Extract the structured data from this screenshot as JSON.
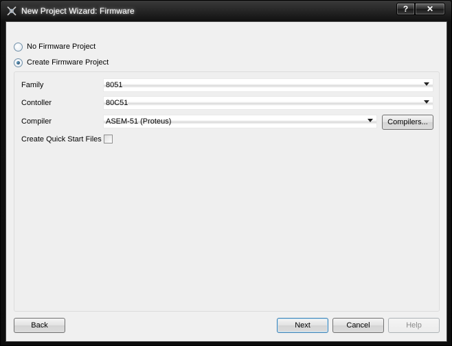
{
  "window": {
    "title": "New Project Wizard: Firmware",
    "help_glyph": "?",
    "close_glyph": "✕"
  },
  "options": {
    "no_firmware": {
      "label": "No Firmware Project",
      "selected": false
    },
    "create_firmware": {
      "label": "Create Firmware Project",
      "selected": true
    }
  },
  "form": {
    "family": {
      "label": "Family",
      "value": "8051"
    },
    "controller": {
      "label": "Contoller",
      "value": "80C51"
    },
    "compiler": {
      "label": "Compiler",
      "value": "ASEM-51 (Proteus)",
      "button_label": "Compilers..."
    },
    "quick_start": {
      "label": "Create Quick Start Files",
      "checked": false
    }
  },
  "footer": {
    "back_label": "Back",
    "next_label": "Next",
    "cancel_label": "Cancel",
    "help_label": "Help"
  }
}
